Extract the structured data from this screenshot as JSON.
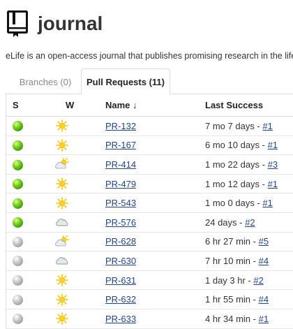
{
  "header": {
    "title": "journal",
    "icon": "book-icon"
  },
  "description": "eLife is an open-access journal that publishes promising research in the life",
  "tabs": [
    {
      "label": "Branches (0)",
      "active": false
    },
    {
      "label": "Pull Requests (11)",
      "active": true
    }
  ],
  "table": {
    "columns": {
      "s": "S",
      "w": "W",
      "name": "Name ↓",
      "last_success": "Last Success"
    },
    "rows": [
      {
        "status": "green",
        "weather": "sunny",
        "name": "PR-132",
        "last": "7 mo 7 days - ",
        "build": "#1"
      },
      {
        "status": "green",
        "weather": "sunny",
        "name": "PR-167",
        "last": "6 mo 10 days - ",
        "build": "#1"
      },
      {
        "status": "green",
        "weather": "partly-cloudy",
        "name": "PR-414",
        "last": "1 mo 22 days - ",
        "build": "#3"
      },
      {
        "status": "green",
        "weather": "sunny",
        "name": "PR-479",
        "last": "1 mo 12 days - ",
        "build": "#1"
      },
      {
        "status": "green",
        "weather": "sunny",
        "name": "PR-543",
        "last": "1 mo 0 days - ",
        "build": "#1"
      },
      {
        "status": "green",
        "weather": "cloudy",
        "name": "PR-576",
        "last": "24 days - ",
        "build": "#2"
      },
      {
        "status": "grey",
        "weather": "partly-cloudy",
        "name": "PR-628",
        "last": "6 hr 27 min - ",
        "build": "#5"
      },
      {
        "status": "grey",
        "weather": "cloudy",
        "name": "PR-630",
        "last": "7 hr 10 min - ",
        "build": "#4"
      },
      {
        "status": "grey",
        "weather": "sunny",
        "name": "PR-631",
        "last": "1 day 3 hr - ",
        "build": "#2"
      },
      {
        "status": "grey",
        "weather": "sunny",
        "name": "PR-632",
        "last": "1 hr 55 min - ",
        "build": "#4"
      },
      {
        "status": "grey",
        "weather": "sunny",
        "name": "PR-633",
        "last": "4 hr 34 min - ",
        "build": "#1"
      }
    ]
  },
  "colors": {
    "link": "#224488",
    "success": "#5cb811",
    "disabled": "#aaaaaa"
  }
}
